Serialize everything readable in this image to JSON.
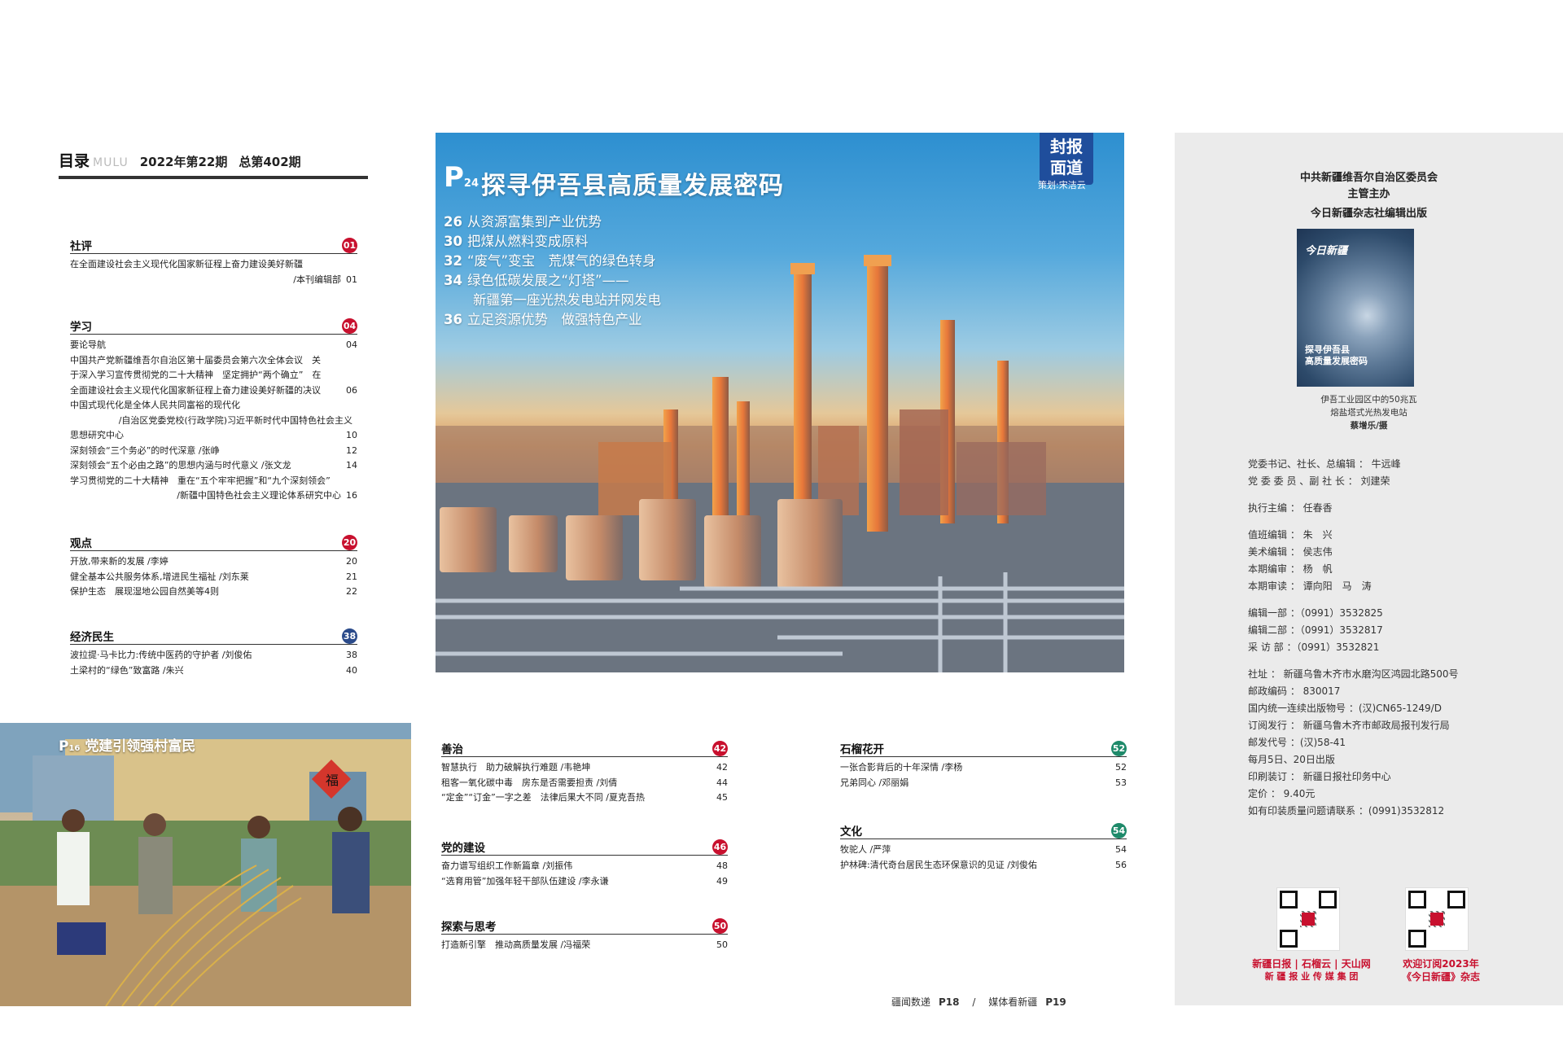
{
  "header": {
    "title": "目录",
    "title_en": "MULU",
    "issue": "2022年第22期",
    "total": "总第402期"
  },
  "sections": {
    "shepin": {
      "name": "社评",
      "badge": "01",
      "items": [
        {
          "t": "在全面建设社会主义现代化国家新征程上奋力建设美好新疆",
          "p": ""
        },
        {
          "t": "/本刊编辑部",
          "p": "01",
          "right": true
        }
      ]
    },
    "xuexi": {
      "name": "学习",
      "badge": "04",
      "items": [
        {
          "t": "要论导航",
          "p": "04"
        },
        {
          "t": "中国共产党新疆维吾尔自治区第十届委员会第六次全体会议　关",
          "p": ""
        },
        {
          "t": "于深入学习宣传贯彻党的二十大精神　坚定拥护“两个确立”　在",
          "p": ""
        },
        {
          "t": "全面建设社会主义现代化国家新征程上奋力建设美好新疆的决议",
          "p": "06"
        },
        {
          "t": "中国式现代化是全体人民共同富裕的现代化",
          "p": ""
        },
        {
          "t": "/自治区党委党校(行政学院)习近平新时代中国特色社会主义",
          "p": "",
          "right": true
        },
        {
          "t": "思想研究中心",
          "p": "10"
        },
        {
          "t": "深刻领会“三个务必”的时代深意 /张峥",
          "p": "12"
        },
        {
          "t": "深刻领会“五个必由之路”的思想内涵与时代意义 /张文龙",
          "p": "14"
        },
        {
          "t": "学习贯彻党的二十大精神　重在“五个牢牢把握”和“九个深刻领会”",
          "p": ""
        },
        {
          "t": "/新疆中国特色社会主义理论体系研究中心",
          "p": "16",
          "right": true
        }
      ]
    },
    "guandian": {
      "name": "观点",
      "badge": "20",
      "items": [
        {
          "t": "开放,带来新的发展 /李婷",
          "p": "20"
        },
        {
          "t": "健全基本公共服务体系,增进民生福祉 /刘东莱",
          "p": "21"
        },
        {
          "t": "保护生态　展现湿地公园自然美等4则",
          "p": "22"
        }
      ]
    },
    "jingji": {
      "name": "经济民生",
      "badge": "38",
      "items": [
        {
          "t": "波拉提·马卡比力:传统中医药的守护者 /刘俊佑",
          "p": "38"
        },
        {
          "t": "土梁村的“绿色”致富路 /朱兴",
          "p": "40"
        }
      ]
    },
    "shanzhi": {
      "name": "善治",
      "badge": "42",
      "items": [
        {
          "t": "智慧执行　助力破解执行难题 /韦艳坤",
          "p": "42"
        },
        {
          "t": "租客一氧化碳中毒　房东是否需要担责 /刘倩",
          "p": "44"
        },
        {
          "t": "“定金”“订金”一字之差　法律后果大不同 /夏克吾热",
          "p": "45"
        }
      ]
    },
    "dangjian": {
      "name": "党的建设",
      "badge": "46",
      "items": [
        {
          "t": "奋力谱写组织工作新篇章 /刘振伟",
          "p": "48"
        },
        {
          "t": "“选育用管”加强年轻干部队伍建设 /李永谦",
          "p": "49"
        }
      ]
    },
    "tansuo": {
      "name": "探索与思考",
      "badge": "50",
      "items": [
        {
          "t": "打造新引擎　推动高质量发展 /冯福荣",
          "p": "50"
        }
      ]
    },
    "shiliu": {
      "name": "石榴花开",
      "badge": "52",
      "items": [
        {
          "t": "一张合影背后的十年深情 /李杨",
          "p": "52"
        },
        {
          "t": "兄弟同心 /邓丽娟",
          "p": "53"
        }
      ]
    },
    "wenhua": {
      "name": "文化",
      "badge": "54",
      "items": [
        {
          "t": "牧驼人 /严萍",
          "p": "54"
        },
        {
          "t": "护林碑:清代奇台居民生态环保意识的见证 /刘俊佑",
          "p": "56"
        }
      ]
    }
  },
  "cover_story": {
    "page": "24",
    "title": "探寻伊吾县高质量发展密码",
    "tag": "封报面道",
    "tag_l1": "封报",
    "tag_l2": "面道",
    "planner": "策划:宋洁云",
    "lines": [
      {
        "p": "26",
        "t": "从资源富集到产业优势"
      },
      {
        "p": "30",
        "t": "把煤从燃料变成原料"
      },
      {
        "p": "32",
        "t": "“废气”变宝　荒煤气的绿色转身"
      },
      {
        "p": "34",
        "t": "绿色低碳发展之“灯塔”——"
      },
      {
        "p": "",
        "t": "新疆第一座光热发电站并网发电"
      },
      {
        "p": "36",
        "t": "立足资源优势　做强特色产业"
      }
    ]
  },
  "photo_story": {
    "page": "16",
    "title": "党建引领强村富民",
    "sign": "福"
  },
  "right_panel": {
    "publisher1": "中共新疆维吾尔自治区委员会",
    "publisher2": "主管主办",
    "publisher3": "今日新疆杂志社编辑出版",
    "thumb_title": "今日新疆",
    "thumb_main": "探寻伊吾县\n高质量发展密码",
    "caption1": "伊吾工业园区中的50兆瓦",
    "caption2": "熔盐塔式光热发电站",
    "caption3": "蔡增乐/摄",
    "staff": [
      "党委书记、社长、总编辑 ： 牛远峰",
      "党 委 委 员 、副 社 长 ： 刘建荣",
      "",
      "执行主编 ： 任春香",
      "",
      "值班编辑 ： 朱　兴",
      "美术编辑 ： 侯志伟",
      "本期编审 ： 杨　帆",
      "本期审读 ： 谭向阳　马　涛",
      "",
      "编辑一部 ：（0991）3532825",
      "编辑二部 ：（0991）3532817",
      "采 访 部 ：（0991）3532821",
      "",
      "社址 ： 新疆乌鲁木齐市水磨沟区鸿园北路500号",
      "邮政编码 ： 830017",
      "国内统一连续出版物号 ：(汉)CN65-1249/D",
      "订阅发行 ： 新疆乌鲁木齐市邮政局报刊发行局",
      "邮发代号 ：(汉)58-41",
      "每月5日、20日出版",
      "印刷装订 ： 新疆日报社印务中心",
      "定价 ： 9.40元",
      "如有印装质量问题请联系 ：(0991)3532812"
    ],
    "brand_left": "新疆日报 | 石榴云 | 天山网",
    "brand_left2": "新 疆 报 业 传 媒 集 团",
    "brand_right": "欢迎订阅2023年",
    "brand_right2": "《今日新疆》杂志"
  },
  "footer": {
    "a": "疆闻数递",
    "pa": "P18",
    "sep": "/",
    "b": "媒体看新疆",
    "pb": "P19"
  },
  "colors": {
    "red": "#c8102e",
    "blue": "#2a4a8a",
    "green": "#1e8a6a",
    "tag": "#1f4e9c"
  }
}
